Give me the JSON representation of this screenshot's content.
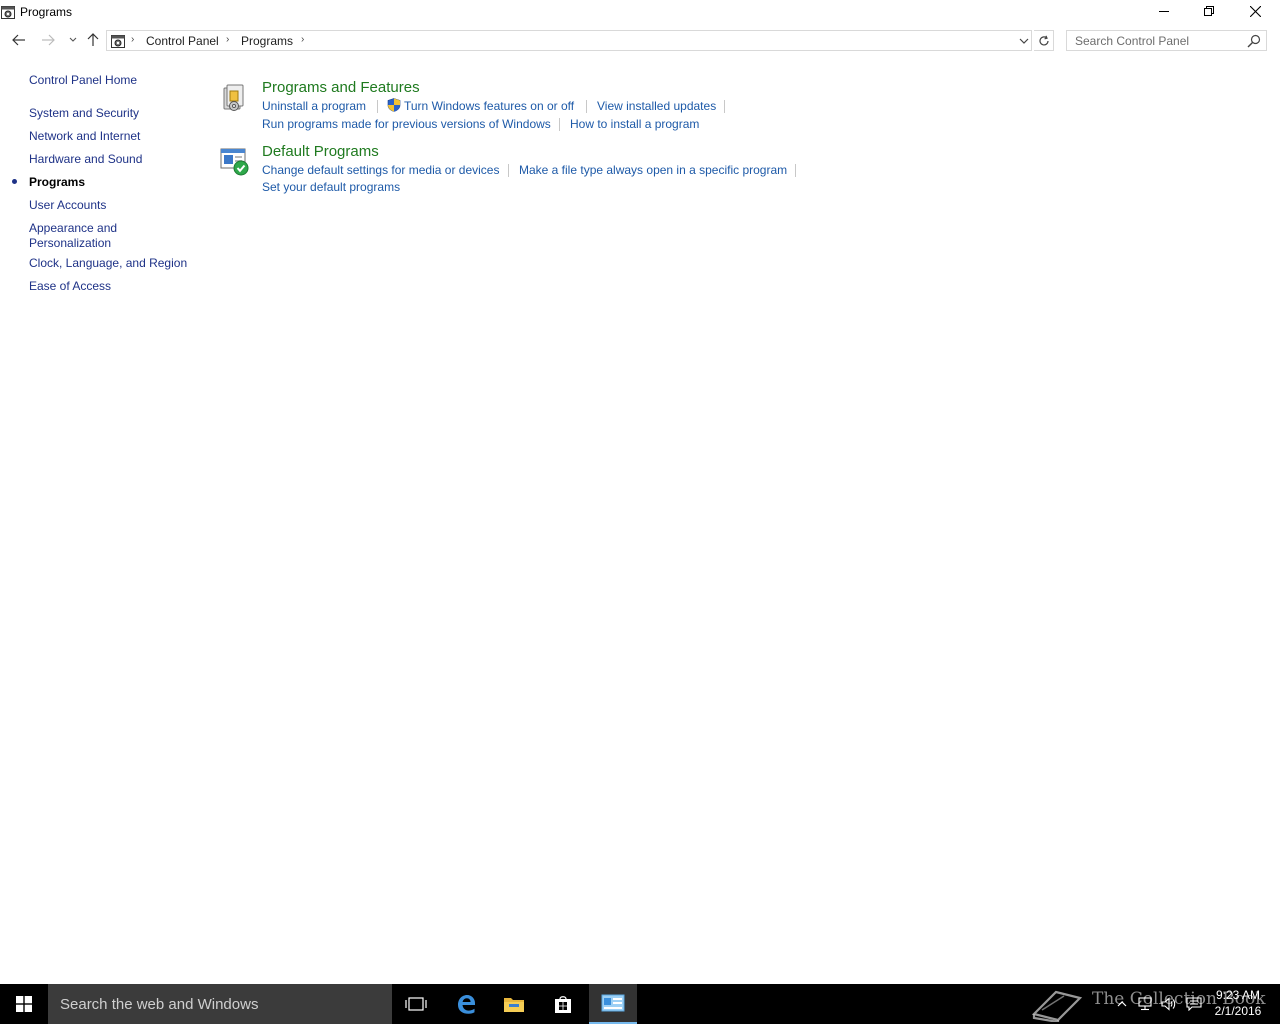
{
  "window": {
    "title": "Programs"
  },
  "address_bar": {
    "breadcrumbs": [
      "Control Panel",
      "Programs"
    ]
  },
  "search": {
    "placeholder": "Search Control Panel"
  },
  "left_nav": {
    "home": "Control Panel Home",
    "items": [
      {
        "label": "System and Security"
      },
      {
        "label": "Network and Internet"
      },
      {
        "label": "Hardware and Sound"
      },
      {
        "label": "Programs",
        "current": true
      },
      {
        "label": "User Accounts"
      },
      {
        "label": "Appearance and",
        "label_line2": "Personalization"
      },
      {
        "label": "Clock, Language, and Region"
      },
      {
        "label": "Ease of Access"
      }
    ]
  },
  "categories": [
    {
      "title": "Programs and Features",
      "links": [
        "Uninstall a program",
        "Turn Windows features on or off",
        "View installed updates",
        "Run programs made for previous versions of Windows",
        "How to install a program"
      ]
    },
    {
      "title": "Default Programs",
      "links": [
        "Change default settings for media or devices",
        "Make a file type always open in a specific program",
        "Set your default programs"
      ]
    }
  ],
  "taskbar": {
    "search_placeholder": "Search the web and Windows",
    "time": "9:23 AM",
    "date": "2/1/2016",
    "watermark": "The Collection Book"
  },
  "colors": {
    "link": "#1e5aa8",
    "nav_link": "#1e3287",
    "category_title": "#1f7a1f",
    "taskbar": "#000000"
  }
}
